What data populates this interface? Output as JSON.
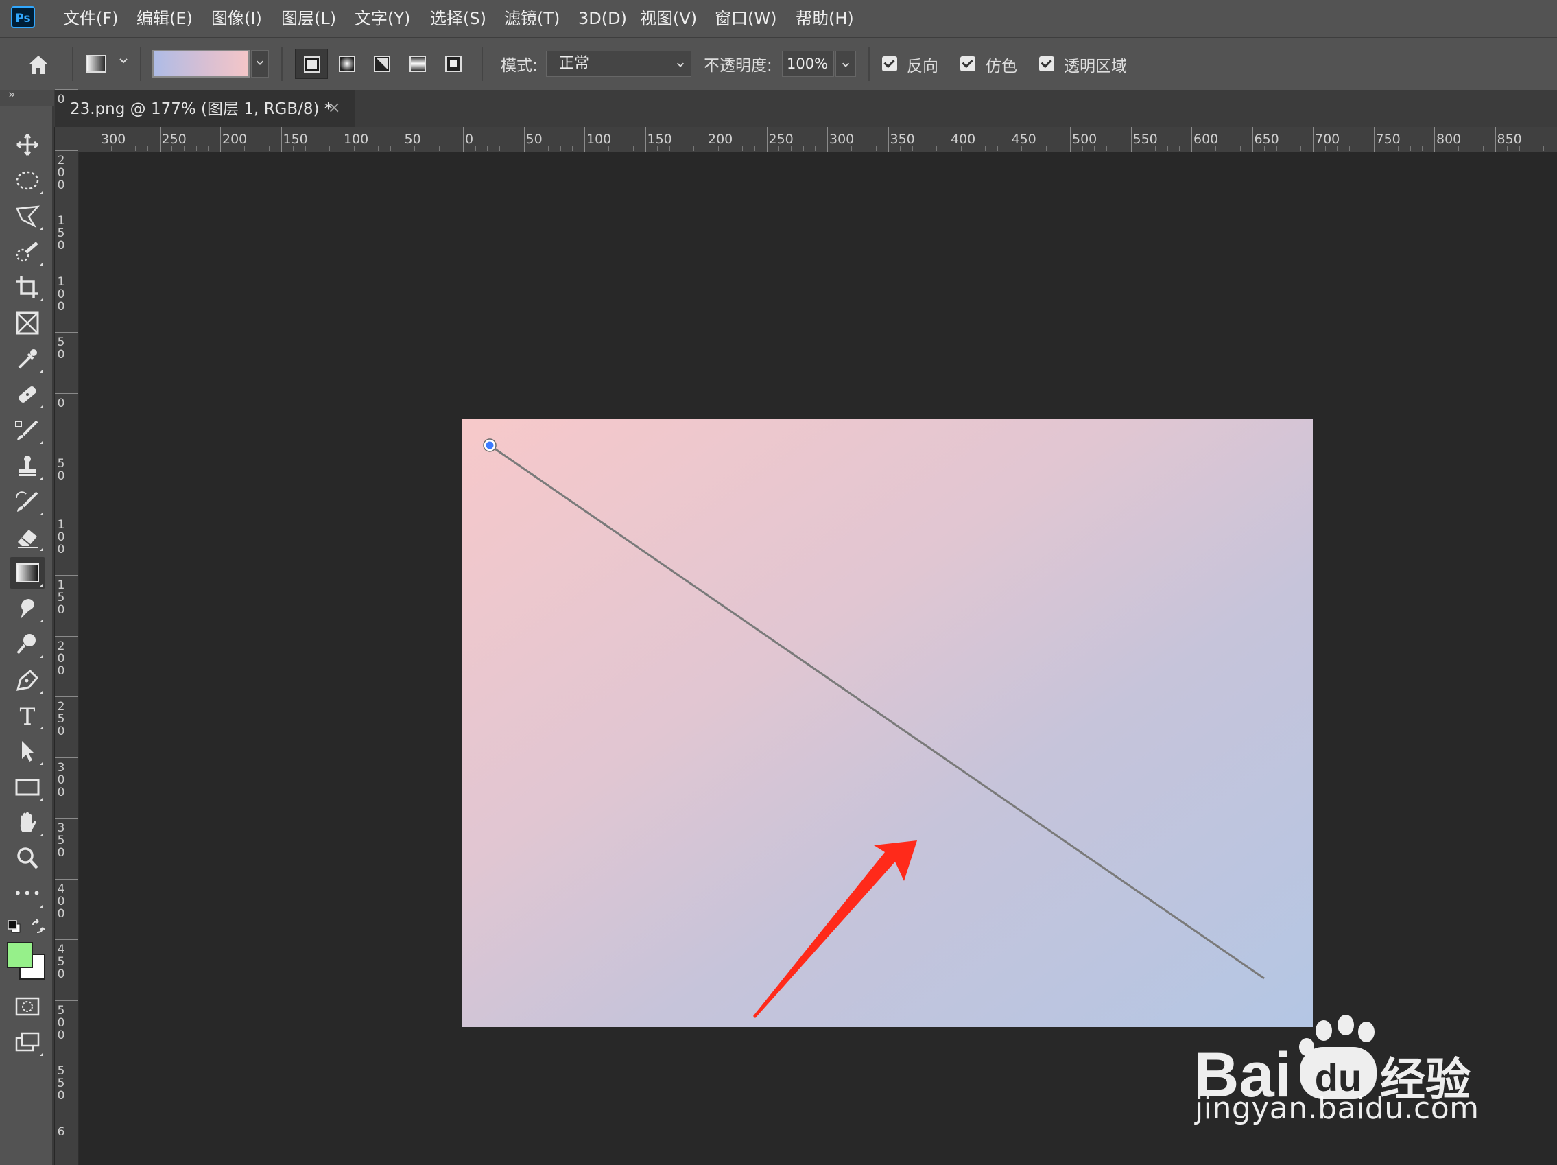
{
  "menu": {
    "app_logo": "Ps",
    "items": [
      "文件(F)",
      "编辑(E)",
      "图像(I)",
      "图层(L)",
      "文字(Y)",
      "选择(S)",
      "滤镜(T)",
      "3D(D)",
      "视图(V)",
      "窗口(W)",
      "帮助(H)"
    ]
  },
  "options": {
    "mode_label": "模式:",
    "mode_value": "正常",
    "opacity_label": "不透明度:",
    "opacity_value": "100%",
    "reverse_label": "反向",
    "reverse_checked": true,
    "dither_label": "仿色",
    "dither_checked": true,
    "transparency_label": "透明区域",
    "transparency_checked": true,
    "gradient_styles": [
      "linear-gradient-icon",
      "radial-gradient-icon",
      "angle-gradient-icon",
      "reflected-gradient-icon",
      "diamond-gradient-icon"
    ],
    "active_style": "linear-gradient-icon",
    "gradient_preview_colors": [
      "#aebce6",
      "#f4c6c8"
    ]
  },
  "document": {
    "tab_title": "23.png @ 177% (图层 1, RGB/8) *",
    "close_glyph": "×"
  },
  "toolbar": {
    "collapse_glyph": "»",
    "tools": [
      "move-tool-icon",
      "elliptical-marquee-icon",
      "polygonal-lasso-icon",
      "quick-selection-icon",
      "crop-tool-icon",
      "frame-tool-icon",
      "eyedropper-icon",
      "healing-brush-icon",
      "brush-tool-icon",
      "clone-stamp-icon",
      "history-brush-icon",
      "eraser-icon",
      "gradient-tool-icon",
      "smudge-tool-icon",
      "dodge-tool-icon",
      "pen-tool-icon",
      "type-tool-icon",
      "path-selection-icon",
      "rectangle-tool-icon",
      "hand-tool-icon",
      "zoom-tool-icon",
      "edit-toolbar-icon"
    ],
    "active_tool": "gradient-tool-icon",
    "foreground_color": "#96f08a",
    "background_color": "#ffffff",
    "type_glyph": "T",
    "more_glyph": "•••"
  },
  "rulers": {
    "horizontal_labels": [
      "300",
      "250",
      "200",
      "150",
      "100",
      "50",
      "0",
      "50",
      "100",
      "150",
      "200",
      "250",
      "300",
      "350",
      "400",
      "450",
      "500",
      "550",
      "600",
      "650",
      "700",
      "750",
      "800",
      "850"
    ],
    "vertical_labels": [
      "0",
      "200",
      "150",
      "100",
      "50",
      "0",
      "50",
      "100",
      "150",
      "200",
      "250",
      "300",
      "350",
      "400",
      "450",
      "500",
      "550",
      "6"
    ]
  },
  "canvas": {
    "gradient_from": "#f7c9ca",
    "gradient_to": "#b4c6e4",
    "arrow_color": "#ff2a1a",
    "drag_line_color": "#7a7a7a"
  },
  "watermark": {
    "brand": "Bai",
    "brand_mid": "du",
    "brand_suffix": "经验",
    "url": "jingyan.baidu.com"
  }
}
